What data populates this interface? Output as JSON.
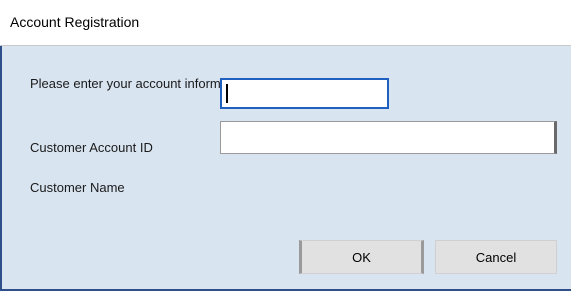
{
  "window": {
    "title": "Account Registration"
  },
  "form": {
    "prompt": "Please enter your account information",
    "customer_account_id_label": "Customer Account ID",
    "customer_account_id_value": "",
    "customer_name_label": "Customer Name",
    "customer_name_value": ""
  },
  "buttons": {
    "ok_label": "OK",
    "cancel_label": "Cancel"
  },
  "colors": {
    "body_background": "#d9e4f1",
    "focus_border": "#1f5fbf",
    "frame_border": "#2f4f8a"
  }
}
